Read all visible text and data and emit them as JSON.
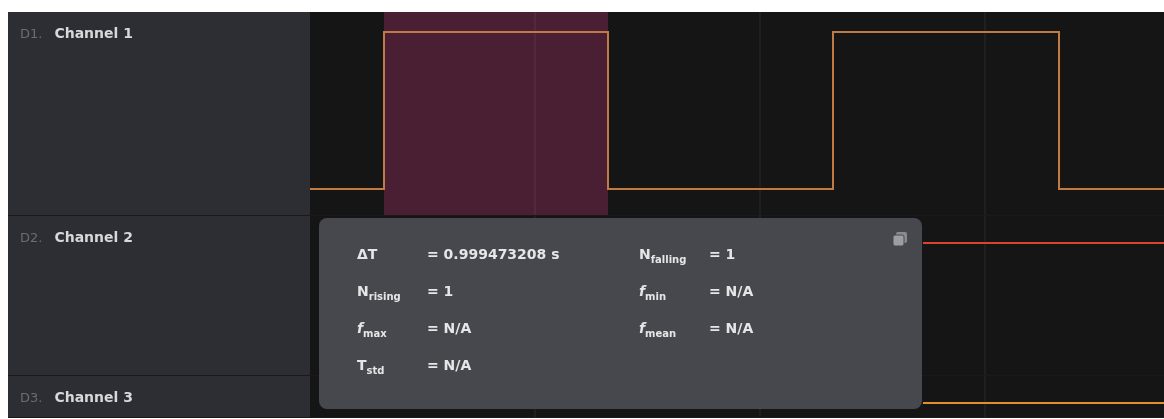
{
  "channels": [
    {
      "index": "D1.",
      "name": "Channel 1",
      "color": "#c07a44"
    },
    {
      "index": "D2.",
      "name": "Channel 2",
      "color": "#d9442b"
    },
    {
      "index": "D3.",
      "name": "Channel 3",
      "color": "#e0902a"
    }
  ],
  "measurements": [
    {
      "label": "ΔT",
      "value": "= 0.999473208 s"
    },
    {
      "label": "N$_{falling}$",
      "value": "= 1"
    },
    {
      "label": "N$_{rising}$",
      "value": "= 1"
    },
    {
      "label": "*f*$_{min}$",
      "value": "= N/A"
    },
    {
      "label": "*f*$_{max}$",
      "value": "= N/A"
    },
    {
      "label": "*f*$_{mean}$",
      "value": "= N/A"
    },
    {
      "label": "T$_{std}$",
      "value": "= N/A"
    }
  ]
}
